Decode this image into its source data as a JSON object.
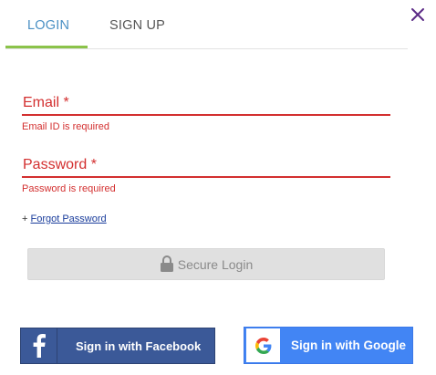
{
  "tabs": {
    "login": "LOGIN",
    "signup": "SIGN UP"
  },
  "form": {
    "email": {
      "label": "Email *",
      "error": "Email ID is required"
    },
    "password": {
      "label": "Password *",
      "error": "Password is required"
    },
    "forgot_prefix": "+ ",
    "forgot_link": "Forgot Password",
    "secure_login": "Secure Login"
  },
  "social": {
    "facebook": "Sign in with Facebook",
    "google": "Sign in with Google"
  },
  "colors": {
    "active_tab": "#4a90c4",
    "tab_underline": "#8bc34a",
    "error": "#d32f2f",
    "close": "#5b2a86",
    "facebook": "#3b5998",
    "google": "#4285f4"
  },
  "icons": [
    "close-icon",
    "lock-icon",
    "facebook-icon",
    "google-icon"
  ]
}
